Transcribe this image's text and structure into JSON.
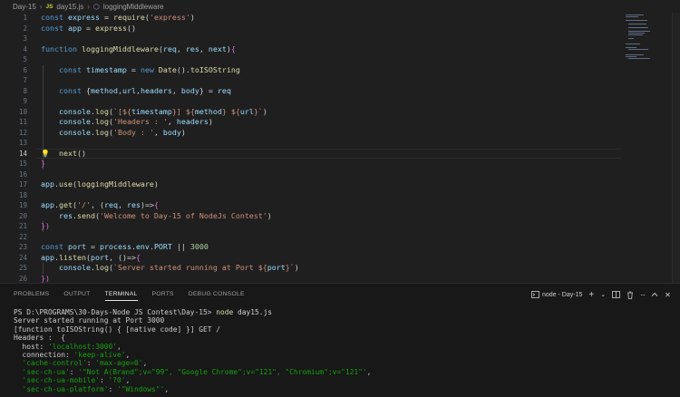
{
  "breadcrumb": {
    "folder": "Day-15",
    "file_badge": "JS",
    "file": "day15.js",
    "symbol": "loggingMiddleware"
  },
  "editor": {
    "current_line": 14,
    "lines": [
      {
        "n": "1",
        "tokens": [
          [
            "b",
            "const "
          ],
          [
            "v",
            "express"
          ],
          [
            "w",
            " = "
          ],
          [
            "y",
            "require"
          ],
          [
            "w",
            "("
          ],
          [
            "s",
            "'express'"
          ],
          [
            "w",
            ")"
          ]
        ]
      },
      {
        "n": "2",
        "tokens": [
          [
            "b",
            "const "
          ],
          [
            "v",
            "app"
          ],
          [
            "w",
            " = "
          ],
          [
            "y",
            "express"
          ],
          [
            "w",
            "()"
          ]
        ]
      },
      {
        "n": "3",
        "tokens": []
      },
      {
        "n": "4",
        "tokens": [
          [
            "b",
            "function "
          ],
          [
            "y",
            "loggingMiddleware"
          ],
          [
            "w",
            "("
          ],
          [
            "v",
            "req"
          ],
          [
            "w",
            ", "
          ],
          [
            "v",
            "res"
          ],
          [
            "w",
            ", "
          ],
          [
            "v",
            "next"
          ],
          [
            "w",
            ")"
          ],
          [
            "p",
            "{"
          ]
        ]
      },
      {
        "n": "5",
        "tokens": []
      },
      {
        "n": "6",
        "tokens": [
          [
            "w",
            "    "
          ],
          [
            "b",
            "const "
          ],
          [
            "v",
            "timestamp"
          ],
          [
            "w",
            " = "
          ],
          [
            "b",
            "new "
          ],
          [
            "y",
            "Date"
          ],
          [
            "w",
            "()."
          ],
          [
            "y",
            "toISOString"
          ]
        ]
      },
      {
        "n": "7",
        "tokens": []
      },
      {
        "n": "8",
        "tokens": [
          [
            "w",
            "    "
          ],
          [
            "b",
            "const "
          ],
          [
            "w",
            "{"
          ],
          [
            "v",
            "method"
          ],
          [
            "w",
            ","
          ],
          [
            "v",
            "url"
          ],
          [
            "w",
            ","
          ],
          [
            "v",
            "headers"
          ],
          [
            "w",
            ", "
          ],
          [
            "v",
            "body"
          ],
          [
            "w",
            "} = "
          ],
          [
            "v",
            "req"
          ]
        ]
      },
      {
        "n": "9",
        "tokens": []
      },
      {
        "n": "10",
        "tokens": [
          [
            "w",
            "    "
          ],
          [
            "v",
            "console"
          ],
          [
            "w",
            "."
          ],
          [
            "y",
            "log"
          ],
          [
            "w",
            "("
          ],
          [
            "s",
            "`[${"
          ],
          [
            "v",
            "timestamp"
          ],
          [
            "s",
            "}] ${"
          ],
          [
            "v",
            "method"
          ],
          [
            "s",
            "} ${"
          ],
          [
            "v",
            "url"
          ],
          [
            "s",
            "}`"
          ],
          [
            "w",
            ")"
          ]
        ]
      },
      {
        "n": "11",
        "tokens": [
          [
            "w",
            "    "
          ],
          [
            "v",
            "console"
          ],
          [
            "w",
            "."
          ],
          [
            "y",
            "log"
          ],
          [
            "w",
            "("
          ],
          [
            "s",
            "'Headers : '"
          ],
          [
            "w",
            ", "
          ],
          [
            "v",
            "headers"
          ],
          [
            "w",
            ")"
          ]
        ]
      },
      {
        "n": "12",
        "tokens": [
          [
            "w",
            "    "
          ],
          [
            "v",
            "console"
          ],
          [
            "w",
            "."
          ],
          [
            "y",
            "log"
          ],
          [
            "w",
            "("
          ],
          [
            "s",
            "'Body : '"
          ],
          [
            "w",
            ", "
          ],
          [
            "v",
            "body"
          ],
          [
            "w",
            ")"
          ]
        ]
      },
      {
        "n": "13",
        "tokens": []
      },
      {
        "n": "14",
        "tokens": [
          [
            "w",
            "    "
          ],
          [
            "y",
            "next"
          ],
          [
            "w",
            "()"
          ]
        ]
      },
      {
        "n": "15",
        "tokens": [
          [
            "p",
            "}"
          ]
        ]
      },
      {
        "n": "16",
        "tokens": []
      },
      {
        "n": "17",
        "tokens": [
          [
            "v",
            "app"
          ],
          [
            "w",
            "."
          ],
          [
            "y",
            "use"
          ],
          [
            "w",
            "("
          ],
          [
            "y",
            "loggingMiddleware"
          ],
          [
            "w",
            ")"
          ]
        ]
      },
      {
        "n": "18",
        "tokens": []
      },
      {
        "n": "19",
        "tokens": [
          [
            "v",
            "app"
          ],
          [
            "w",
            "."
          ],
          [
            "y",
            "get"
          ],
          [
            "w",
            "("
          ],
          [
            "s",
            "'/'"
          ],
          [
            "w",
            ", ("
          ],
          [
            "v",
            "req"
          ],
          [
            "w",
            ", "
          ],
          [
            "v",
            "res"
          ],
          [
            "w",
            ")=>"
          ],
          [
            "p",
            "{"
          ]
        ]
      },
      {
        "n": "20",
        "tokens": [
          [
            "w",
            "    "
          ],
          [
            "v",
            "res"
          ],
          [
            "w",
            "."
          ],
          [
            "y",
            "send"
          ],
          [
            "w",
            "("
          ],
          [
            "s",
            "'Welcome to Day-15 of NodeJs Contest'"
          ],
          [
            "w",
            ")"
          ]
        ]
      },
      {
        "n": "21",
        "tokens": [
          [
            "p",
            "})"
          ]
        ]
      },
      {
        "n": "22",
        "tokens": []
      },
      {
        "n": "23",
        "tokens": [
          [
            "b",
            "const "
          ],
          [
            "v",
            "port"
          ],
          [
            "w",
            " = "
          ],
          [
            "v",
            "process"
          ],
          [
            "w",
            "."
          ],
          [
            "v",
            "env"
          ],
          [
            "w",
            "."
          ],
          [
            "v",
            "PORT"
          ],
          [
            "w",
            " || "
          ],
          [
            "n",
            "3000"
          ]
        ]
      },
      {
        "n": "24",
        "tokens": [
          [
            "v",
            "app"
          ],
          [
            "w",
            "."
          ],
          [
            "y",
            "listen"
          ],
          [
            "w",
            "("
          ],
          [
            "v",
            "port"
          ],
          [
            "w",
            ", ()=>"
          ],
          [
            "p",
            "{"
          ]
        ]
      },
      {
        "n": "25",
        "tokens": [
          [
            "w",
            "    "
          ],
          [
            "v",
            "console"
          ],
          [
            "w",
            "."
          ],
          [
            "y",
            "log"
          ],
          [
            "w",
            "("
          ],
          [
            "s",
            "`Server started running at Port ${"
          ],
          [
            "v",
            "port"
          ],
          [
            "s",
            "}`"
          ],
          [
            "w",
            ")"
          ]
        ]
      },
      {
        "n": "26",
        "tokens": [
          [
            "p",
            "})"
          ]
        ]
      }
    ]
  },
  "panel": {
    "tabs": [
      {
        "label": "PROBLEMS",
        "active": false
      },
      {
        "label": "OUTPUT",
        "active": false
      },
      {
        "label": "TERMINAL",
        "active": true
      },
      {
        "label": "PORTS",
        "active": false
      },
      {
        "label": "DEBUG CONSOLE",
        "active": false
      }
    ],
    "session_label": "node - Day-15",
    "terminal_lines": [
      [
        [
          "tk-key",
          "PS D:\\PROGRAMS\\30-Days-Node JS Contest\\Day-15> "
        ],
        [
          "y",
          "node"
        ],
        [
          "w",
          " day15.js"
        ]
      ],
      [
        [
          "tk-key",
          "Server started running at Port 3000"
        ]
      ],
      [
        [
          "tk-key",
          "[function toISOString() { [native code] }] GET /"
        ]
      ],
      [
        [
          "tk-key",
          "Headers :  {"
        ]
      ],
      [
        [
          "tk-key",
          "  host: "
        ],
        [
          "tk-str",
          "'localhost:3000'"
        ],
        [
          "tk-key",
          ","
        ]
      ],
      [
        [
          "tk-key",
          "  connection: "
        ],
        [
          "tk-str",
          "'keep-alive'"
        ],
        [
          "tk-key",
          ","
        ]
      ],
      [
        [
          "tk-key",
          "  "
        ],
        [
          "tk-str",
          "'cache-control'"
        ],
        [
          "tk-key",
          ": "
        ],
        [
          "tk-str",
          "'max-age=0'"
        ],
        [
          "tk-key",
          ","
        ]
      ],
      [
        [
          "tk-key",
          "  "
        ],
        [
          "tk-str",
          "'sec-ch-ua'"
        ],
        [
          "tk-key",
          ": "
        ],
        [
          "tk-str",
          "'\"Not A(Brand\";v=\"99\", \"Google Chrome\";v=\"121\", \"Chromium\";v=\"121\"'"
        ],
        [
          "tk-key",
          ","
        ]
      ],
      [
        [
          "tk-key",
          "  "
        ],
        [
          "tk-str",
          "'sec-ch-ua-mobile'"
        ],
        [
          "tk-key",
          ": "
        ],
        [
          "tk-str",
          "'?0'"
        ],
        [
          "tk-key",
          ","
        ]
      ],
      [
        [
          "tk-key",
          "  "
        ],
        [
          "tk-str",
          "'sec-ch-ua-platform'"
        ],
        [
          "tk-key",
          ": "
        ],
        [
          "tk-str",
          "'\"Windows\"'"
        ],
        [
          "tk-key",
          ","
        ]
      ]
    ]
  }
}
